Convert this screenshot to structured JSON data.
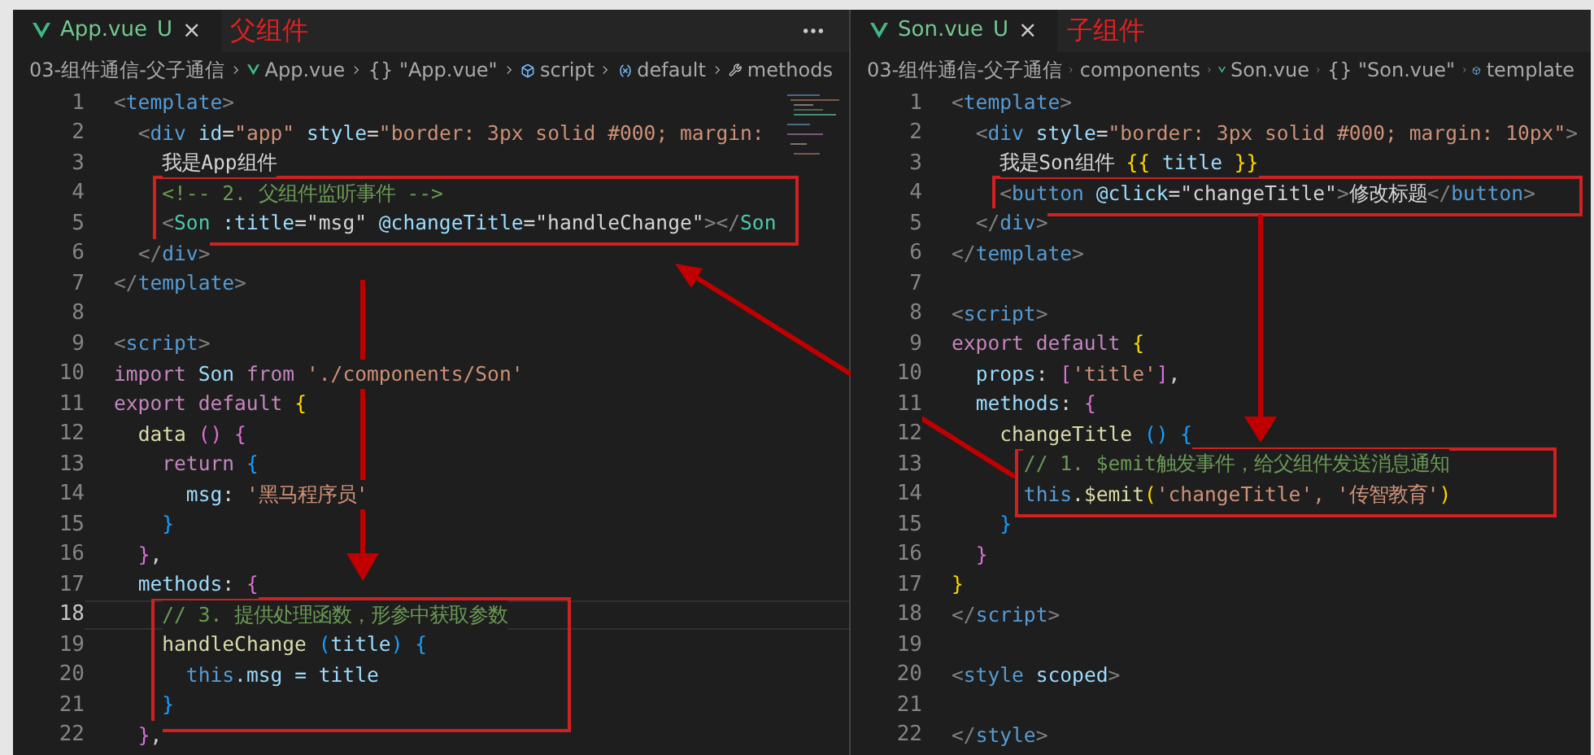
{
  "panes": [
    {
      "tab": {
        "file": "App.vue",
        "status": "U",
        "close": "×",
        "selected": true
      },
      "note": "父组件",
      "breadcrumbs": [
        {
          "kind": "folder",
          "label": "03-组件通信-父子通信"
        },
        {
          "kind": "vue",
          "label": "App.vue"
        },
        {
          "kind": "plain",
          "label": "{} \"App.vue\""
        },
        {
          "kind": "cube",
          "label": "script"
        },
        {
          "kind": "variable",
          "label": "default"
        },
        {
          "kind": "wrench",
          "label": "methods"
        }
      ],
      "lines": [
        {
          "number": "1",
          "active": false,
          "tokens": [
            {
              "kind": "punct",
              "text": "<"
            },
            {
              "kind": "tag",
              "text": "template"
            },
            {
              "kind": "punct",
              "text": ">"
            }
          ]
        },
        {
          "number": "2",
          "active": false,
          "tokens": [
            {
              "kind": "punct",
              "text": "  <"
            },
            {
              "kind": "tag",
              "text": "div "
            },
            {
              "kind": "attr",
              "text": "id"
            },
            {
              "kind": "plain",
              "text": "="
            },
            {
              "kind": "string",
              "text": "\"app\" "
            },
            {
              "kind": "attr",
              "text": "style"
            },
            {
              "kind": "plain",
              "text": "="
            },
            {
              "kind": "string",
              "text": "\"border: 3px solid #000; margin:"
            }
          ]
        },
        {
          "number": "3",
          "active": false,
          "tokens": [
            {
              "kind": "plain",
              "text": "    我是App组件"
            }
          ]
        },
        {
          "number": "4",
          "active": false,
          "tokens": [
            {
              "kind": "comment",
              "text": "    <!-- 2. 父组件监听事件 -->"
            }
          ]
        },
        {
          "number": "5",
          "active": false,
          "tokens": [
            {
              "kind": "punct",
              "text": "    <"
            },
            {
              "kind": "component",
              "text": "Son "
            },
            {
              "kind": "attr",
              "text": ":title"
            },
            {
              "kind": "plain",
              "text": "=\"msg\" "
            },
            {
              "kind": "attr",
              "text": "@changeTitle"
            },
            {
              "kind": "plain",
              "text": "=\"handleChange\""
            },
            {
              "kind": "punct",
              "text": "></"
            },
            {
              "kind": "component",
              "text": "Son"
            }
          ]
        },
        {
          "number": "6",
          "active": false,
          "tokens": [
            {
              "kind": "punct",
              "text": "  </"
            },
            {
              "kind": "tag",
              "text": "div"
            },
            {
              "kind": "punct",
              "text": ">"
            }
          ]
        },
        {
          "number": "7",
          "active": false,
          "tokens": [
            {
              "kind": "punct",
              "text": "</"
            },
            {
              "kind": "tag",
              "text": "template"
            },
            {
              "kind": "punct",
              "text": ">"
            }
          ]
        },
        {
          "number": "8",
          "active": false
        },
        {
          "number": "9",
          "active": false,
          "tokens": [
            {
              "kind": "punct",
              "text": "<"
            },
            {
              "kind": "tag",
              "text": "script"
            },
            {
              "kind": "punct",
              "text": ">"
            }
          ]
        },
        {
          "number": "10",
          "active": false,
          "tokens": [
            {
              "kind": "keyword",
              "text": "import "
            },
            {
              "kind": "variable",
              "text": "Son "
            },
            {
              "kind": "keyword",
              "text": "from "
            },
            {
              "kind": "string",
              "text": "'./components/Son'"
            }
          ]
        },
        {
          "number": "11",
          "active": false,
          "tokens": [
            {
              "kind": "keyword",
              "text": "export default "
            },
            {
              "kind": "brace1",
              "text": "{"
            }
          ]
        },
        {
          "number": "12",
          "active": false,
          "tokens": [
            {
              "kind": "function",
              "text": "  data "
            },
            {
              "kind": "brace2",
              "text": "() {"
            }
          ]
        },
        {
          "number": "13",
          "active": false,
          "tokens": [
            {
              "kind": "keyword",
              "text": "    return "
            },
            {
              "kind": "brace3",
              "text": "{"
            }
          ]
        },
        {
          "number": "14",
          "active": false,
          "tokens": [
            {
              "kind": "variable",
              "text": "      msg"
            },
            {
              "kind": "plain",
              "text": ": "
            },
            {
              "kind": "string",
              "text": "'黑马程序员'"
            }
          ]
        },
        {
          "number": "15",
          "active": false,
          "tokens": [
            {
              "kind": "brace3",
              "text": "    }"
            }
          ]
        },
        {
          "number": "16",
          "active": false,
          "tokens": [
            {
              "kind": "brace2",
              "text": "  }"
            },
            {
              "kind": "plain",
              "text": ","
            }
          ]
        },
        {
          "number": "17",
          "active": false,
          "tokens": [
            {
              "kind": "variable",
              "text": "  methods"
            },
            {
              "kind": "plain",
              "text": ": "
            },
            {
              "kind": "brace2",
              "text": "{"
            }
          ]
        },
        {
          "number": "18",
          "active": true,
          "tokens": [
            {
              "kind": "comment",
              "text": "    // 3. 提供处理函数，形参中获取参数"
            }
          ]
        },
        {
          "number": "19",
          "active": false,
          "tokens": [
            {
              "kind": "function",
              "text": "    handleChange "
            },
            {
              "kind": "brace3",
              "text": "("
            },
            {
              "kind": "variable",
              "text": "title"
            },
            {
              "kind": "brace3",
              "text": ") {"
            }
          ]
        },
        {
          "number": "20",
          "active": false,
          "tokens": [
            {
              "kind": "this",
              "text": "      this"
            },
            {
              "kind": "variable",
              "text": ".msg = title"
            }
          ]
        },
        {
          "number": "21",
          "active": false,
          "tokens": [
            {
              "kind": "brace3",
              "text": "    }"
            }
          ]
        },
        {
          "number": "22",
          "active": false,
          "tokens": [
            {
              "kind": "brace2",
              "text": "  }"
            },
            {
              "kind": "plain",
              "text": ","
            }
          ]
        }
      ]
    },
    {
      "tab": {
        "file": "Son.vue",
        "status": "U",
        "close": "×",
        "selected": true
      },
      "note": "子组件",
      "breadcrumbs": [
        {
          "kind": "folder",
          "label": "03-组件通信-父子通信"
        },
        {
          "kind": "folder",
          "label": "components"
        },
        {
          "kind": "vue",
          "label": "Son.vue"
        },
        {
          "kind": "plain",
          "label": "{} \"Son.vue\""
        },
        {
          "kind": "cube",
          "label": "template"
        }
      ],
      "lines": [
        {
          "number": "1",
          "active": false,
          "tokens": [
            {
              "kind": "punct",
              "text": "<"
            },
            {
              "kind": "tag",
              "text": "template"
            },
            {
              "kind": "punct",
              "text": ">"
            }
          ]
        },
        {
          "number": "2",
          "active": false,
          "tokens": [
            {
              "kind": "punct",
              "text": "  <"
            },
            {
              "kind": "tag",
              "text": "div "
            },
            {
              "kind": "attr",
              "text": "style"
            },
            {
              "kind": "plain",
              "text": "="
            },
            {
              "kind": "string",
              "text": "\"border: 3px solid #000; margin: 10px\""
            },
            {
              "kind": "punct",
              "text": ">"
            }
          ]
        },
        {
          "number": "3",
          "active": false,
          "tokens": [
            {
              "kind": "plain",
              "text": "    我是Son组件 "
            },
            {
              "kind": "brace1",
              "text": "{{ "
            },
            {
              "kind": "variable",
              "text": "title "
            },
            {
              "kind": "brace1",
              "text": "}}"
            }
          ]
        },
        {
          "number": "4",
          "active": false,
          "tokens": [
            {
              "kind": "punct",
              "text": "    <"
            },
            {
              "kind": "tag",
              "text": "button "
            },
            {
              "kind": "attr",
              "text": "@click"
            },
            {
              "kind": "plain",
              "text": "=\"changeTitle\""
            },
            {
              "kind": "punct",
              "text": ">"
            },
            {
              "kind": "plain",
              "text": "修改标题"
            },
            {
              "kind": "punct",
              "text": "</"
            },
            {
              "kind": "tag",
              "text": "button"
            },
            {
              "kind": "punct",
              "text": ">"
            }
          ]
        },
        {
          "number": "5",
          "active": false,
          "tokens": [
            {
              "kind": "punct",
              "text": "  </"
            },
            {
              "kind": "tag",
              "text": "div"
            },
            {
              "kind": "punct",
              "text": ">"
            }
          ]
        },
        {
          "number": "6",
          "active": false,
          "tokens": [
            {
              "kind": "punct",
              "text": "</"
            },
            {
              "kind": "tag",
              "text": "template"
            },
            {
              "kind": "punct",
              "text": ">"
            }
          ]
        },
        {
          "number": "7",
          "active": false
        },
        {
          "number": "8",
          "active": false,
          "tokens": [
            {
              "kind": "punct",
              "text": "<"
            },
            {
              "kind": "tag",
              "text": "script"
            },
            {
              "kind": "punct",
              "text": ">"
            }
          ]
        },
        {
          "number": "9",
          "active": false,
          "tokens": [
            {
              "kind": "keyword",
              "text": "export default "
            },
            {
              "kind": "brace1",
              "text": "{"
            }
          ]
        },
        {
          "number": "10",
          "active": false,
          "tokens": [
            {
              "kind": "variable",
              "text": "  props"
            },
            {
              "kind": "plain",
              "text": ": "
            },
            {
              "kind": "brace2",
              "text": "["
            },
            {
              "kind": "string",
              "text": "'title'"
            },
            {
              "kind": "brace2",
              "text": "]"
            },
            {
              "kind": "plain",
              "text": ","
            }
          ]
        },
        {
          "number": "11",
          "active": false,
          "tokens": [
            {
              "kind": "variable",
              "text": "  methods"
            },
            {
              "kind": "plain",
              "text": ": "
            },
            {
              "kind": "brace2",
              "text": "{"
            }
          ]
        },
        {
          "number": "12",
          "active": false,
          "tokens": [
            {
              "kind": "function",
              "text": "    changeTitle "
            },
            {
              "kind": "brace3",
              "text": "() {"
            }
          ]
        },
        {
          "number": "13",
          "active": false,
          "tokens": [
            {
              "kind": "comment",
              "text": "      // 1. $emit触发事件，给父组件发送消息通知"
            }
          ]
        },
        {
          "number": "14",
          "active": false,
          "tokens": [
            {
              "kind": "this",
              "text": "      this"
            },
            {
              "kind": "function",
              "text": ".$emit"
            },
            {
              "kind": "brace1",
              "text": "("
            },
            {
              "kind": "string",
              "text": "'changeTitle', '传智教育'"
            },
            {
              "kind": "brace1",
              "text": ")"
            }
          ]
        },
        {
          "number": "15",
          "active": false,
          "tokens": [
            {
              "kind": "brace3",
              "text": "    }"
            }
          ]
        },
        {
          "number": "16",
          "active": false,
          "tokens": [
            {
              "kind": "brace2",
              "text": "  }"
            }
          ]
        },
        {
          "number": "17",
          "active": false,
          "tokens": [
            {
              "kind": "brace1",
              "text": "}"
            }
          ]
        },
        {
          "number": "18",
          "active": false,
          "tokens": [
            {
              "kind": "punct",
              "text": "</"
            },
            {
              "kind": "tag",
              "text": "script"
            },
            {
              "kind": "punct",
              "text": ">"
            }
          ]
        },
        {
          "number": "19",
          "active": false
        },
        {
          "number": "20",
          "active": false,
          "tokens": [
            {
              "kind": "punct",
              "text": "<"
            },
            {
              "kind": "tag",
              "text": "style "
            },
            {
              "kind": "attr",
              "text": "scoped"
            },
            {
              "kind": "punct",
              "text": ">"
            }
          ]
        },
        {
          "number": "21",
          "active": false
        },
        {
          "number": "22",
          "active": false,
          "tokens": [
            {
              "kind": "punct",
              "text": "</"
            },
            {
              "kind": "tag",
              "text": "style"
            },
            {
              "kind": "punct",
              "text": ">"
            }
          ]
        }
      ]
    }
  ]
}
